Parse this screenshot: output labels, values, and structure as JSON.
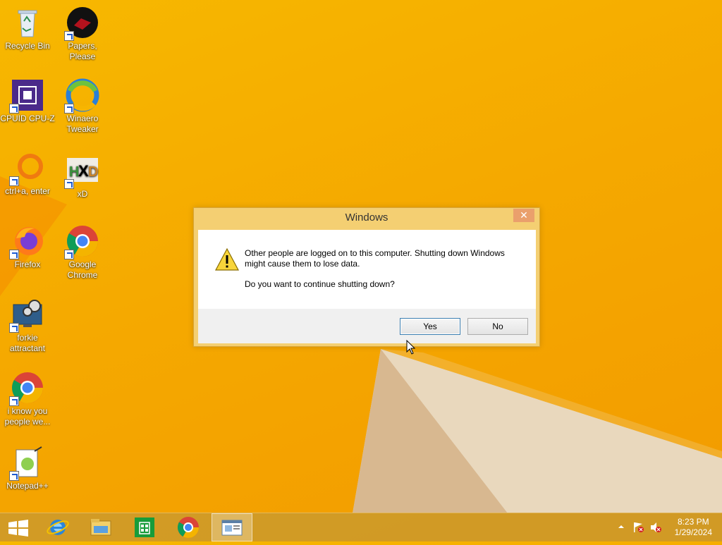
{
  "desktop": {
    "icons": [
      {
        "label": "Recycle Bin"
      },
      {
        "label": "Papers, Please"
      },
      {
        "label": "CPUID CPU-Z"
      },
      {
        "label": "Winaero Tweaker"
      },
      {
        "label": "ctrl+a, enter"
      },
      {
        "label": "xD"
      },
      {
        "label": "Firefox"
      },
      {
        "label": "Google Chrome"
      },
      {
        "label": "forkie attractant"
      },
      {
        "label": "i know you people we..."
      },
      {
        "label": "Notepad++"
      }
    ]
  },
  "dialog": {
    "title": "Windows",
    "close_label": "✕",
    "message_line1": "Other people are logged on to this computer. Shutting down Windows might cause them to lose data.",
    "message_line2": "Do you want to continue shutting down?",
    "yes_label": "Yes",
    "no_label": "No",
    "icon": "warning-icon"
  },
  "taskbar": {
    "items": [
      "start-button",
      "internet-explorer-icon",
      "file-explorer-icon",
      "store-icon",
      "chrome-icon",
      "active-window-icon"
    ],
    "tray": {
      "time": "8:23 PM",
      "date": "1/29/2024",
      "icons": [
        "show-hidden-icons-arrow",
        "action-center-flag-icon",
        "volume-muted-icon"
      ]
    }
  },
  "colors": {
    "wallpaper": "#f5a900",
    "dialog_frame": "#f4cf72",
    "close_button": "#eaa06c",
    "taskbar": "#ce9a28"
  }
}
